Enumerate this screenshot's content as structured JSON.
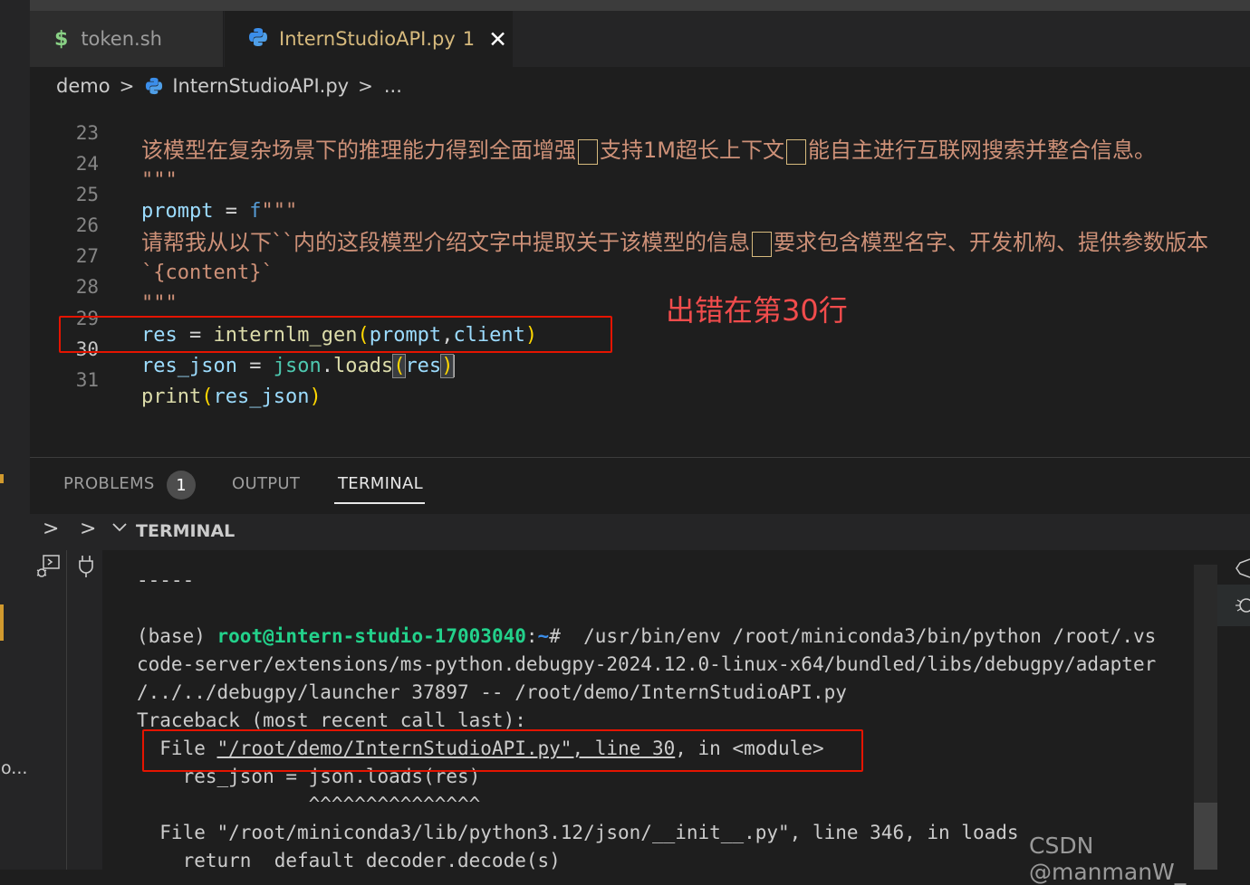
{
  "tabs": [
    {
      "name": "token.sh",
      "icon": "shell-dollar-icon"
    },
    {
      "name": "InternStudioAPI.py",
      "problems": "1",
      "icon": "python-icon"
    }
  ],
  "breadcrumb": {
    "folder": "demo",
    "file": "InternStudioAPI.py",
    "more": "..."
  },
  "editor": {
    "line_numbers": [
      "23",
      "24",
      "25",
      "26",
      "27",
      "28",
      "29",
      "30",
      "31"
    ],
    "line23_a": "该模型在复杂场景下的推理能力得到全面增强",
    "line23_b": "支持1M超长上下文",
    "line23_c": "能自主进行互联网搜索并整合信息。",
    "line24": "\"\"\"",
    "line25_var": "prompt",
    "line25_op": " = ",
    "line25_f": "f",
    "line25_str": "\"\"\"",
    "line26_a": "请帮我从以下``内的这段模型介绍文字中提取关于该模型的信息",
    "line26_b": "要求包含模型名字、开发机构、提供参数版本",
    "line27": "`{content}`",
    "line28": "\"\"\"",
    "line29": {
      "var": "res",
      "op": " = ",
      "fn": "internlm_gen",
      "arg1": "prompt",
      "comma": ",",
      "arg2": "client"
    },
    "line30": {
      "var": "res_json",
      "op": " = ",
      "mod": "json",
      "dot": ".",
      "fn": "loads",
      "arg": "res"
    },
    "line31": {
      "fn": "print",
      "arg": "res_json"
    }
  },
  "annotation": "出错在第30行",
  "panel": {
    "tabs": {
      "problems": "PROBLEMS",
      "problems_count": "1",
      "output": "OUTPUT",
      "terminal": "TERMINAL"
    },
    "terminal_section": "TERMINAL"
  },
  "terminal": {
    "line_dashes": "-----",
    "prompt_base": "(base) ",
    "prompt_user": "root@intern-studio-17003040",
    "prompt_colon": ":",
    "prompt_path": "~",
    "prompt_hash": "#  /usr/bin/env /root/miniconda3/bin/python /root/.vs",
    "line2": "code-server/extensions/ms-python.debugpy-2024.12.0-linux-x64/bundled/libs/debugpy/adapter",
    "line3": "/../../debugpy/launcher 37897 -- /root/demo/InternStudioAPI.py",
    "line4": "Traceback (most recent call last):",
    "line5_a": "  File ",
    "line5_link": "\"/root/demo/InternStudioAPI.py\", line 30",
    "line5_b": ", in <module>",
    "line6": "    res_json = json.loads(res)",
    "line7": "               ^^^^^^^^^^^^^^^",
    "line8": "  File \"/root/miniconda3/lib/python3.12/json/__init__.py\", line 346, in loads",
    "line9": "    return _default_decoder.decode(s)"
  },
  "watermark": "CSDN @manmanW_",
  "colors": {
    "accent_red": "#e51400",
    "annotation_red": "#f14c4c",
    "terminal_green": "#23d18b",
    "tab_modified": "#d7ba7d"
  }
}
